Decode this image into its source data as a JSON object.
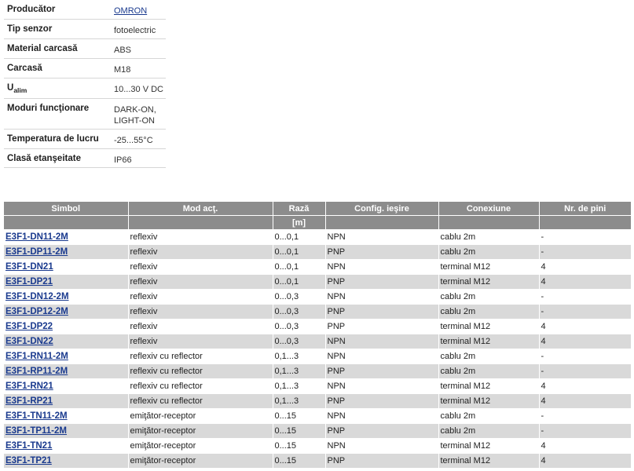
{
  "specs": {
    "producator": {
      "label": "Producător",
      "value": "OMRON"
    },
    "tip_senzor": {
      "label": "Tip senzor",
      "value": "fotoelectric"
    },
    "material": {
      "label": "Material carcasă",
      "value": "ABS"
    },
    "carcasa": {
      "label": "Carcasă",
      "value": "M18"
    },
    "ualim": {
      "label_main": "U",
      "label_sub": "alim",
      "value": "10...30 V DC"
    },
    "moduri": {
      "label": "Moduri funcţionare",
      "value_line1": "DARK-ON,",
      "value_line2": "LIGHT-ON"
    },
    "temperatura": {
      "label": "Temperatura de lucru",
      "value": "-25...55°C"
    },
    "clasa": {
      "label": "Clasă etanşeitate",
      "value": "IP66"
    }
  },
  "products": {
    "headers": {
      "symbol": "Simbol",
      "mode": "Mod acţ.",
      "range": "Rază",
      "range_unit": "[m]",
      "output": "Config. ieşire",
      "connection": "Conexiune",
      "pins": "Nr. de pini"
    },
    "rows": [
      {
        "symbol": "E3F1-DN11-2M",
        "mode": "reflexiv",
        "range": "0...0,1",
        "output": "NPN",
        "connection": "cablu 2m",
        "pins": "-"
      },
      {
        "symbol": "E3F1-DP11-2M",
        "mode": "reflexiv",
        "range": "0...0,1",
        "output": "PNP",
        "connection": "cablu 2m",
        "pins": "-"
      },
      {
        "symbol": "E3F1-DN21",
        "mode": "reflexiv",
        "range": "0...0,1",
        "output": "NPN",
        "connection": "terminal M12",
        "pins": "4"
      },
      {
        "symbol": "E3F1-DP21",
        "mode": "reflexiv",
        "range": "0...0,1",
        "output": "PNP",
        "connection": "terminal M12",
        "pins": "4"
      },
      {
        "symbol": "E3F1-DN12-2M",
        "mode": "reflexiv",
        "range": "0...0,3",
        "output": "NPN",
        "connection": "cablu 2m",
        "pins": "-"
      },
      {
        "symbol": "E3F1-DP12-2M",
        "mode": "reflexiv",
        "range": "0...0,3",
        "output": "PNP",
        "connection": "cablu 2m",
        "pins": "-"
      },
      {
        "symbol": "E3F1-DP22",
        "mode": "reflexiv",
        "range": "0...0,3",
        "output": "PNP",
        "connection": "terminal M12",
        "pins": "4"
      },
      {
        "symbol": "E3F1-DN22",
        "mode": "reflexiv",
        "range": "0...0,3",
        "output": "NPN",
        "connection": "terminal M12",
        "pins": "4"
      },
      {
        "symbol": "E3F1-RN11-2M",
        "mode": "reflexiv cu reflector",
        "range": "0,1...3",
        "output": "NPN",
        "connection": "cablu 2m",
        "pins": "-"
      },
      {
        "symbol": "E3F1-RP11-2M",
        "mode": "reflexiv cu reflector",
        "range": "0,1...3",
        "output": "PNP",
        "connection": "cablu 2m",
        "pins": "-"
      },
      {
        "symbol": "E3F1-RN21",
        "mode": "reflexiv cu reflector",
        "range": "0,1...3",
        "output": "NPN",
        "connection": "terminal M12",
        "pins": "4"
      },
      {
        "symbol": "E3F1-RP21",
        "mode": "reflexiv cu reflector",
        "range": "0,1...3",
        "output": "PNP",
        "connection": "terminal M12",
        "pins": "4"
      },
      {
        "symbol": "E3F1-TN11-2M",
        "mode": "emiţător-receptor",
        "range": "0...15",
        "output": "NPN",
        "connection": "cablu 2m",
        "pins": "-"
      },
      {
        "symbol": "E3F1-TP11-2M",
        "mode": "emiţător-receptor",
        "range": "0...15",
        "output": "PNP",
        "connection": "cablu 2m",
        "pins": "-"
      },
      {
        "symbol": "E3F1-TN21",
        "mode": "emiţător-receptor",
        "range": "0...15",
        "output": "NPN",
        "connection": "terminal M12",
        "pins": "4"
      },
      {
        "symbol": "E3F1-TP21",
        "mode": "emiţător-receptor",
        "range": "0...15",
        "output": "PNP",
        "connection": "terminal M12",
        "pins": "4"
      }
    ]
  }
}
